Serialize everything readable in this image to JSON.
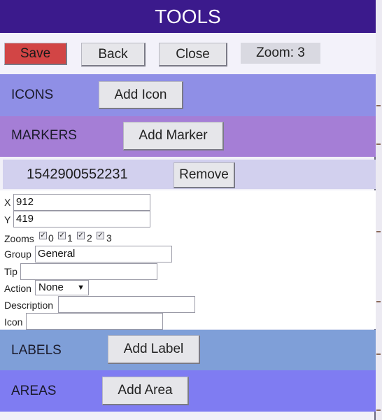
{
  "title": "TOOLS",
  "toolbar": {
    "save_label": "Save",
    "back_label": "Back",
    "close_label": "Close",
    "zoom_text": "Zoom: 3"
  },
  "sections": {
    "icons": {
      "label": "ICONS",
      "button": "Add Icon"
    },
    "markers": {
      "label": "MARKERS",
      "button": "Add Marker"
    },
    "labels": {
      "label": "LABELS",
      "button": "Add Label"
    },
    "areas": {
      "label": "AREAS",
      "button": "Add Area"
    }
  },
  "marker": {
    "id": "1542900552231",
    "remove_label": "Remove",
    "x_label": "X",
    "x_value": "912",
    "y_label": "Y",
    "y_value": "419",
    "zooms_label": "Zooms",
    "zooms": [
      "0",
      "1",
      "2",
      "3"
    ],
    "group_label": "Group",
    "group_value": "General",
    "tip_label": "Tip",
    "tip_value": "",
    "action_label": "Action",
    "action_value": "None",
    "description_label": "Description",
    "description_value": "",
    "icon_label": "Icon",
    "icon_value": ""
  },
  "colors": {
    "title_bg": "#3b1a8c",
    "save_bg": "#d24545",
    "icons_bg": "#8f8fe6",
    "markers_bg": "#a57ed6",
    "marker_row_bg": "#d2d0ee",
    "labels_bg": "#7f9fd8",
    "areas_bg": "#7f7cf2"
  }
}
